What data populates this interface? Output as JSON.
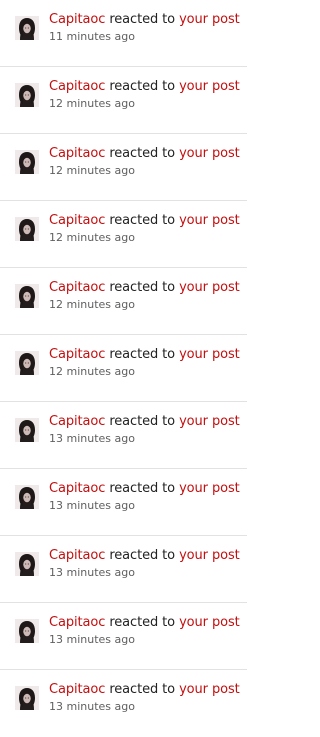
{
  "colors": {
    "link": "#c30f0f",
    "text": "#222222",
    "muted": "#5f5f5f",
    "divider": "#e2e2e2"
  },
  "notifications": [
    {
      "user": "Capitaoc",
      "action": "reacted to",
      "target": "your post",
      "time": "11 minutes ago",
      "avatar_icon": "user-avatar"
    },
    {
      "user": "Capitaoc",
      "action": "reacted to",
      "target": "your post",
      "time": "12 minutes ago",
      "avatar_icon": "user-avatar"
    },
    {
      "user": "Capitaoc",
      "action": "reacted to",
      "target": "your post",
      "time": "12 minutes ago",
      "avatar_icon": "user-avatar"
    },
    {
      "user": "Capitaoc",
      "action": "reacted to",
      "target": "your post",
      "time": "12 minutes ago",
      "avatar_icon": "user-avatar"
    },
    {
      "user": "Capitaoc",
      "action": "reacted to",
      "target": "your post",
      "time": "12 minutes ago",
      "avatar_icon": "user-avatar"
    },
    {
      "user": "Capitaoc",
      "action": "reacted to",
      "target": "your post",
      "time": "12 minutes ago",
      "avatar_icon": "user-avatar"
    },
    {
      "user": "Capitaoc",
      "action": "reacted to",
      "target": "your post",
      "time": "13 minutes ago",
      "avatar_icon": "user-avatar"
    },
    {
      "user": "Capitaoc",
      "action": "reacted to",
      "target": "your post",
      "time": "13 minutes ago",
      "avatar_icon": "user-avatar"
    },
    {
      "user": "Capitaoc",
      "action": "reacted to",
      "target": "your post",
      "time": "13 minutes ago",
      "avatar_icon": "user-avatar"
    },
    {
      "user": "Capitaoc",
      "action": "reacted to",
      "target": "your post",
      "time": "13 minutes ago",
      "avatar_icon": "user-avatar"
    },
    {
      "user": "Capitaoc",
      "action": "reacted to",
      "target": "your post",
      "time": "13 minutes ago",
      "avatar_icon": "user-avatar"
    }
  ]
}
